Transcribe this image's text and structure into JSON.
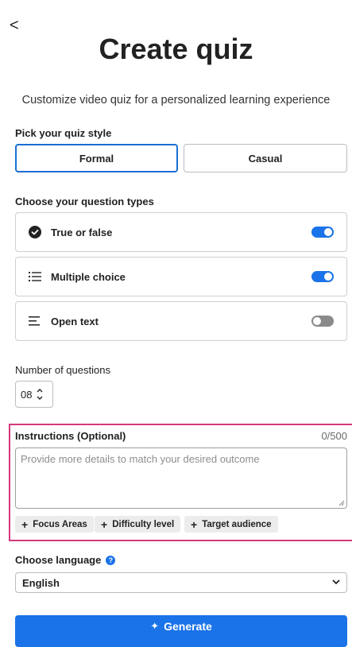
{
  "header": {
    "back_label": "<",
    "title": "Create quiz",
    "subtitle": "Customize video quiz for a personalized learning experience"
  },
  "style": {
    "label": "Pick your quiz style",
    "options": [
      "Formal",
      "Casual"
    ],
    "selected": "Formal"
  },
  "question_types": {
    "label": "Choose your question types",
    "items": [
      {
        "label": "True or false",
        "icon": "check-circle-icon",
        "enabled": true
      },
      {
        "label": "Multiple choice",
        "icon": "list-icon",
        "enabled": true
      },
      {
        "label": "Open text",
        "icon": "align-left-icon",
        "enabled": false
      }
    ]
  },
  "num_questions": {
    "label": "Number of questions",
    "value": "08"
  },
  "instructions": {
    "label": "Instructions (Optional)",
    "counter": "0/500",
    "placeholder": "Provide more details to match your desired outcome",
    "chips": [
      "Focus Areas",
      "Difficulty level",
      "Target audience"
    ]
  },
  "language": {
    "label": "Choose language",
    "selected": "English"
  },
  "generate": {
    "label": "Generate"
  },
  "colors": {
    "accent": "#1a73e8",
    "highlight_border": "#d4387e"
  }
}
